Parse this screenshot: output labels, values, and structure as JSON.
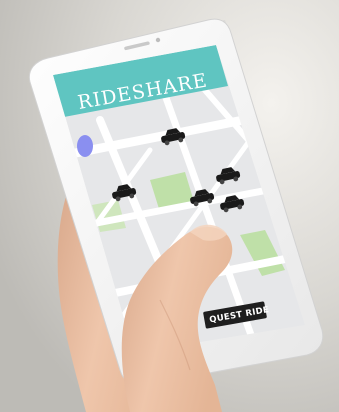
{
  "app": {
    "title": "RIDESHARE",
    "header_color": "#5fc5c1"
  },
  "map": {
    "car_icon": "car-icon",
    "location_marker_color": "#8a8ff0",
    "park_color": "#bfe0a8",
    "road_color": "#ffffff",
    "block_color": "#e6e7e9"
  },
  "actions": {
    "request_button_label": "QUEST RIDE",
    "request_button_color": "#1f1f1f"
  }
}
